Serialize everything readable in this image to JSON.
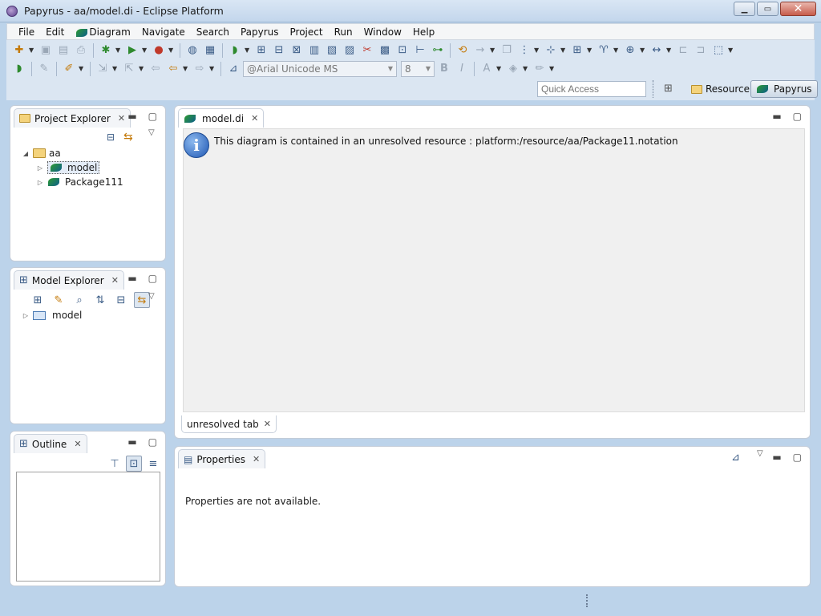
{
  "window": {
    "title": "Papyrus - aa/model.di - Eclipse Platform"
  },
  "menubar": [
    "File",
    "Edit",
    "Diagram",
    "Navigate",
    "Search",
    "Papyrus",
    "Project",
    "Run",
    "Window",
    "Help"
  ],
  "toolbar2": {
    "font_combo": "@Arial Unicode MS",
    "size_combo": "8"
  },
  "quick_access": {
    "placeholder": "Quick Access"
  },
  "perspectives": {
    "resource": "Resource",
    "papyrus": "Papyrus"
  },
  "project_explorer": {
    "title": "Project Explorer",
    "root": "aa",
    "children": [
      "model",
      "Package111"
    ]
  },
  "model_explorer": {
    "title": "Model Explorer",
    "root": "model"
  },
  "outline": {
    "title": "Outline"
  },
  "editor": {
    "tab": "model.di",
    "message": "This diagram is contained in an unresolved resource : platform:/resource/aa/Package11.notation",
    "bottom_tab": "unresolved tab"
  },
  "properties": {
    "title": "Properties",
    "message": "Properties are not available."
  }
}
